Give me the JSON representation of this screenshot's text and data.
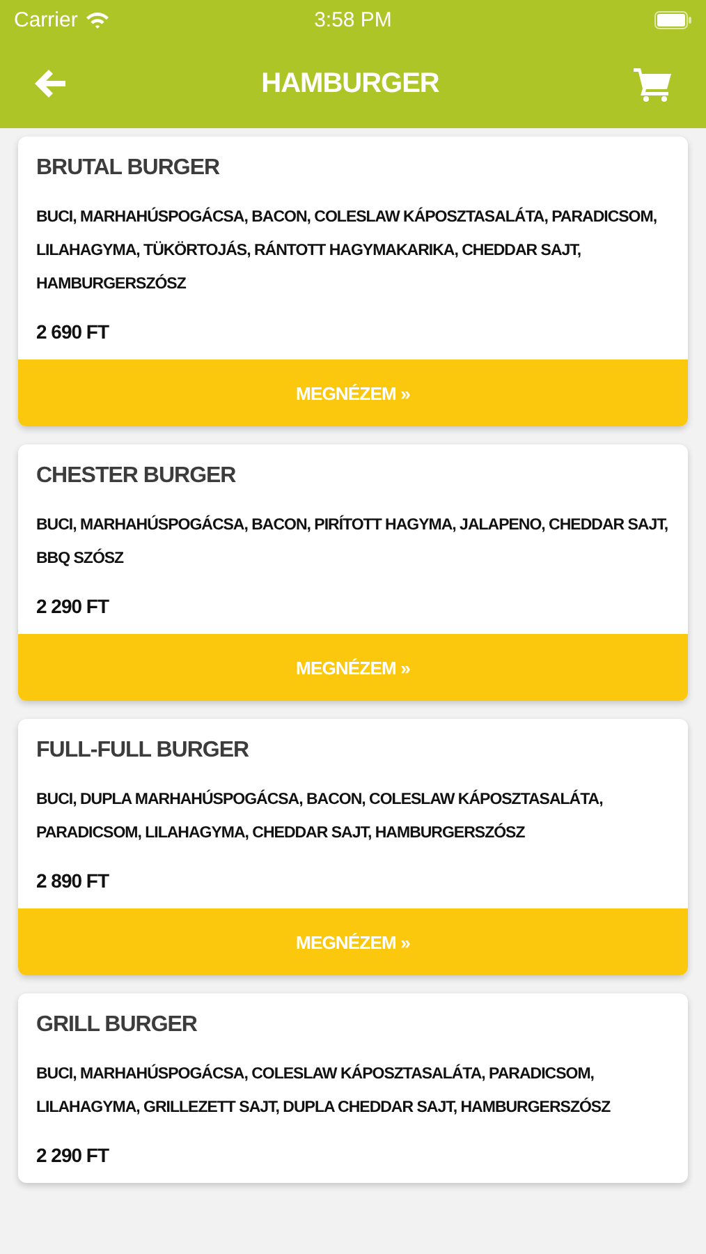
{
  "status_bar": {
    "carrier": "Carrier",
    "time": "3:58 PM"
  },
  "header": {
    "title": "HAMBURGER"
  },
  "products": [
    {
      "name": "BRUTAL BURGER",
      "description": "BUCI, MARHAHÚSPOGÁCSA, BACON, COLESLAW KÁPOSZTASALÁTA, PARADICSOM, LILAHAGYMA, TÜKÖRTOJÁS, RÁNTOTT HAGYMAKARIKA, CHEDDAR SAJT, HAMBURGERSZÓSZ",
      "price": "2 690 FT",
      "button": "MEGNÉZEM »"
    },
    {
      "name": "CHESTER BURGER",
      "description": "BUCI, MARHAHÚSPOGÁCSA, BACON, PIRÍTOTT HAGYMA, JALAPENO, CHEDDAR SAJT, BBQ SZÓSZ",
      "price": "2 290 FT",
      "button": "MEGNÉZEM »"
    },
    {
      "name": "FULL-FULL BURGER",
      "description": "BUCI, DUPLA MARHAHÚSPOGÁCSA, BACON, COLESLAW KÁPOSZTASALÁTA, PARADICSOM, LILAHAGYMA, CHEDDAR SAJT, HAMBURGERSZÓSZ",
      "price": "2 890 FT",
      "button": "MEGNÉZEM »"
    },
    {
      "name": "GRILL BURGER",
      "description": "BUCI, MARHAHÚSPOGÁCSA, COLESLAW KÁPOSZTASALÁTA, PARADICSOM, LILAHAGYMA, GRILLEZETT SAJT, DUPLA CHEDDAR SAJT, HAMBURGERSZÓSZ",
      "price": "2 290 FT"
    }
  ]
}
